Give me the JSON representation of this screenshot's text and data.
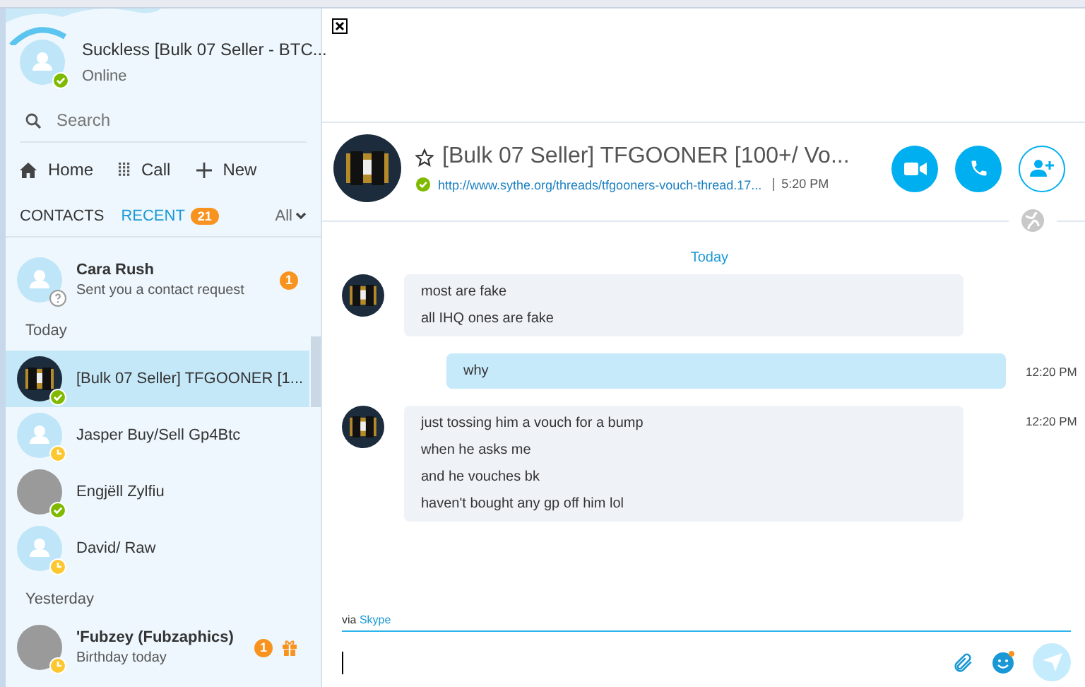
{
  "profile": {
    "name": "Suckless [Bulk 07 Seller - BTC...",
    "status": "Online",
    "presence": {
      "kind": "online"
    }
  },
  "search": {
    "placeholder": "Search"
  },
  "nav": [
    {
      "label": "Home",
      "kind": "home"
    },
    {
      "label": "Call",
      "kind": "dialpad"
    },
    {
      "label": "New",
      "kind": "plus"
    }
  ],
  "tabs": [
    {
      "label": "CONTACTS",
      "selected": false
    },
    {
      "label": "RECENT",
      "selected": true,
      "badge": "21"
    }
  ],
  "filter": "All",
  "list": [
    {
      "kind": "contact",
      "name": "Cara Rush",
      "subtitle": "Sent you a contact request",
      "presence": {
        "kind": "unknown"
      },
      "avatar": {
        "kind": "default"
      },
      "unread": "1",
      "selected": false
    },
    {
      "kind": "header",
      "label": "Today"
    },
    {
      "kind": "contact",
      "name": "[Bulk 07 Seller] TFGOONER [1...",
      "presence": {
        "kind": "online"
      },
      "avatar": {
        "kind": "logo"
      },
      "selected": true
    },
    {
      "kind": "contact",
      "name": "Jasper Buy/Sell Gp4Btc",
      "presence": {
        "kind": "away"
      },
      "avatar": {
        "kind": "default"
      },
      "selected": false
    },
    {
      "kind": "contact",
      "name": "Engjëll Zylfiu",
      "presence": {
        "kind": "online"
      },
      "avatar": {
        "kind": "photo"
      },
      "selected": false
    },
    {
      "kind": "contact",
      "name": "David/ Raw",
      "presence": {
        "kind": "away"
      },
      "avatar": {
        "kind": "default"
      },
      "selected": false
    },
    {
      "kind": "header",
      "label": "Yesterday"
    },
    {
      "kind": "contact",
      "name": "'Fubzey (Fubzaphics)",
      "subtitle": "Birthday today",
      "presence": {
        "kind": "away"
      },
      "avatar": {
        "kind": "photo"
      },
      "unread": "1",
      "gift": true,
      "selected": false
    }
  ],
  "conversation": {
    "title": "[Bulk 07 Seller] TFGOONER [100+/ Vo...",
    "link": "http://www.sythe.org/threads/tfgooners-vouch-thread.17...",
    "time": "5:20 PM",
    "presence": {
      "kind": "online"
    },
    "favorite": false
  },
  "messages": [
    {
      "kind": "date",
      "label": "Today"
    },
    {
      "kind": "incoming",
      "lines": [
        "most are fake",
        "all IHQ ones are fake"
      ]
    },
    {
      "kind": "outgoing",
      "lines": [
        "why"
      ],
      "time": "12:20 PM"
    },
    {
      "kind": "incoming",
      "lines": [
        "just tossing him a vouch for a bump",
        "when he asks me",
        "and he vouches bk",
        "haven't bought any gp off him lol"
      ],
      "time": "12:20 PM"
    }
  ],
  "composer": {
    "via": "via",
    "service": "Skype"
  }
}
